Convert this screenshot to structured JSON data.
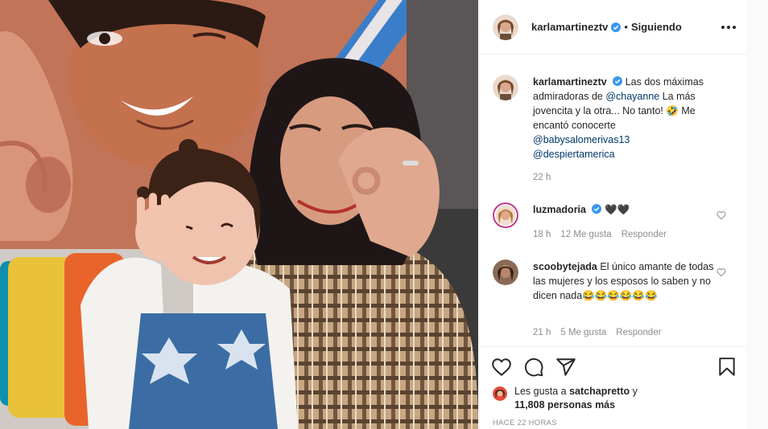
{
  "header": {
    "username": "karlamartineztv",
    "separator": "•",
    "follow_label": "Siguiendo"
  },
  "caption": {
    "username": "karlamartineztv",
    "text_1": "Las dos máximas admiradoras de ",
    "mention_1": "@chayanne",
    "text_2": " La más jovencita y la otra... No tanto! 🤣 Me encantó conocerte ",
    "mention_2": "@babysalomerivas13",
    "mention_3": "@despiertamerica",
    "time": "22 h"
  },
  "comments": [
    {
      "username": "luzmadoria",
      "text": "🖤🖤",
      "time": "18 h",
      "likes": "12 Me gusta",
      "reply": "Responder"
    },
    {
      "username": "scoobytejada",
      "text": "El único amante de todas las mujeres y los esposos lo saben y no dicen nada😂😂😂😂😂😂",
      "time": "21 h",
      "likes": "5 Me gusta",
      "reply": "Responder"
    }
  ],
  "likes": {
    "prefix": "Les gusta a ",
    "user": "satchapretto",
    "connector": " y",
    "count": "11,808 personas más"
  },
  "timestamp": "HACE 22 HORAS",
  "icons": {
    "like": "heart-icon",
    "comment": "comment-icon",
    "share": "share-icon",
    "save": "bookmark-icon",
    "verified": "verified-badge-icon",
    "more": "more-options-icon"
  },
  "colors": {
    "verified": "#3897f0",
    "link": "#00376b",
    "muted": "#8e8e8e",
    "text": "#262626"
  }
}
